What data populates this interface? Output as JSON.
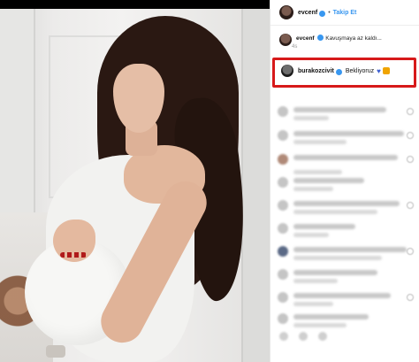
{
  "post": {
    "author": "evcenf",
    "follow_label": "Takip Et",
    "dot": "•"
  },
  "caption": {
    "user": "evcenf",
    "text": "Kavuşmaya az kaldı...",
    "meta": "4s"
  },
  "highlighted_comment": {
    "user": "burakozcivit",
    "text": "Bekliyoruz",
    "heart_icon": "♥",
    "highlight_color": "#d7191a"
  },
  "colors": {
    "accent": "#3897f0",
    "verified": "#3897f0"
  },
  "icons": [
    "avatar",
    "verified-badge",
    "heart-icon",
    "cat-emoji",
    "comment-icon",
    "share-icon",
    "bookmark-icon"
  ]
}
